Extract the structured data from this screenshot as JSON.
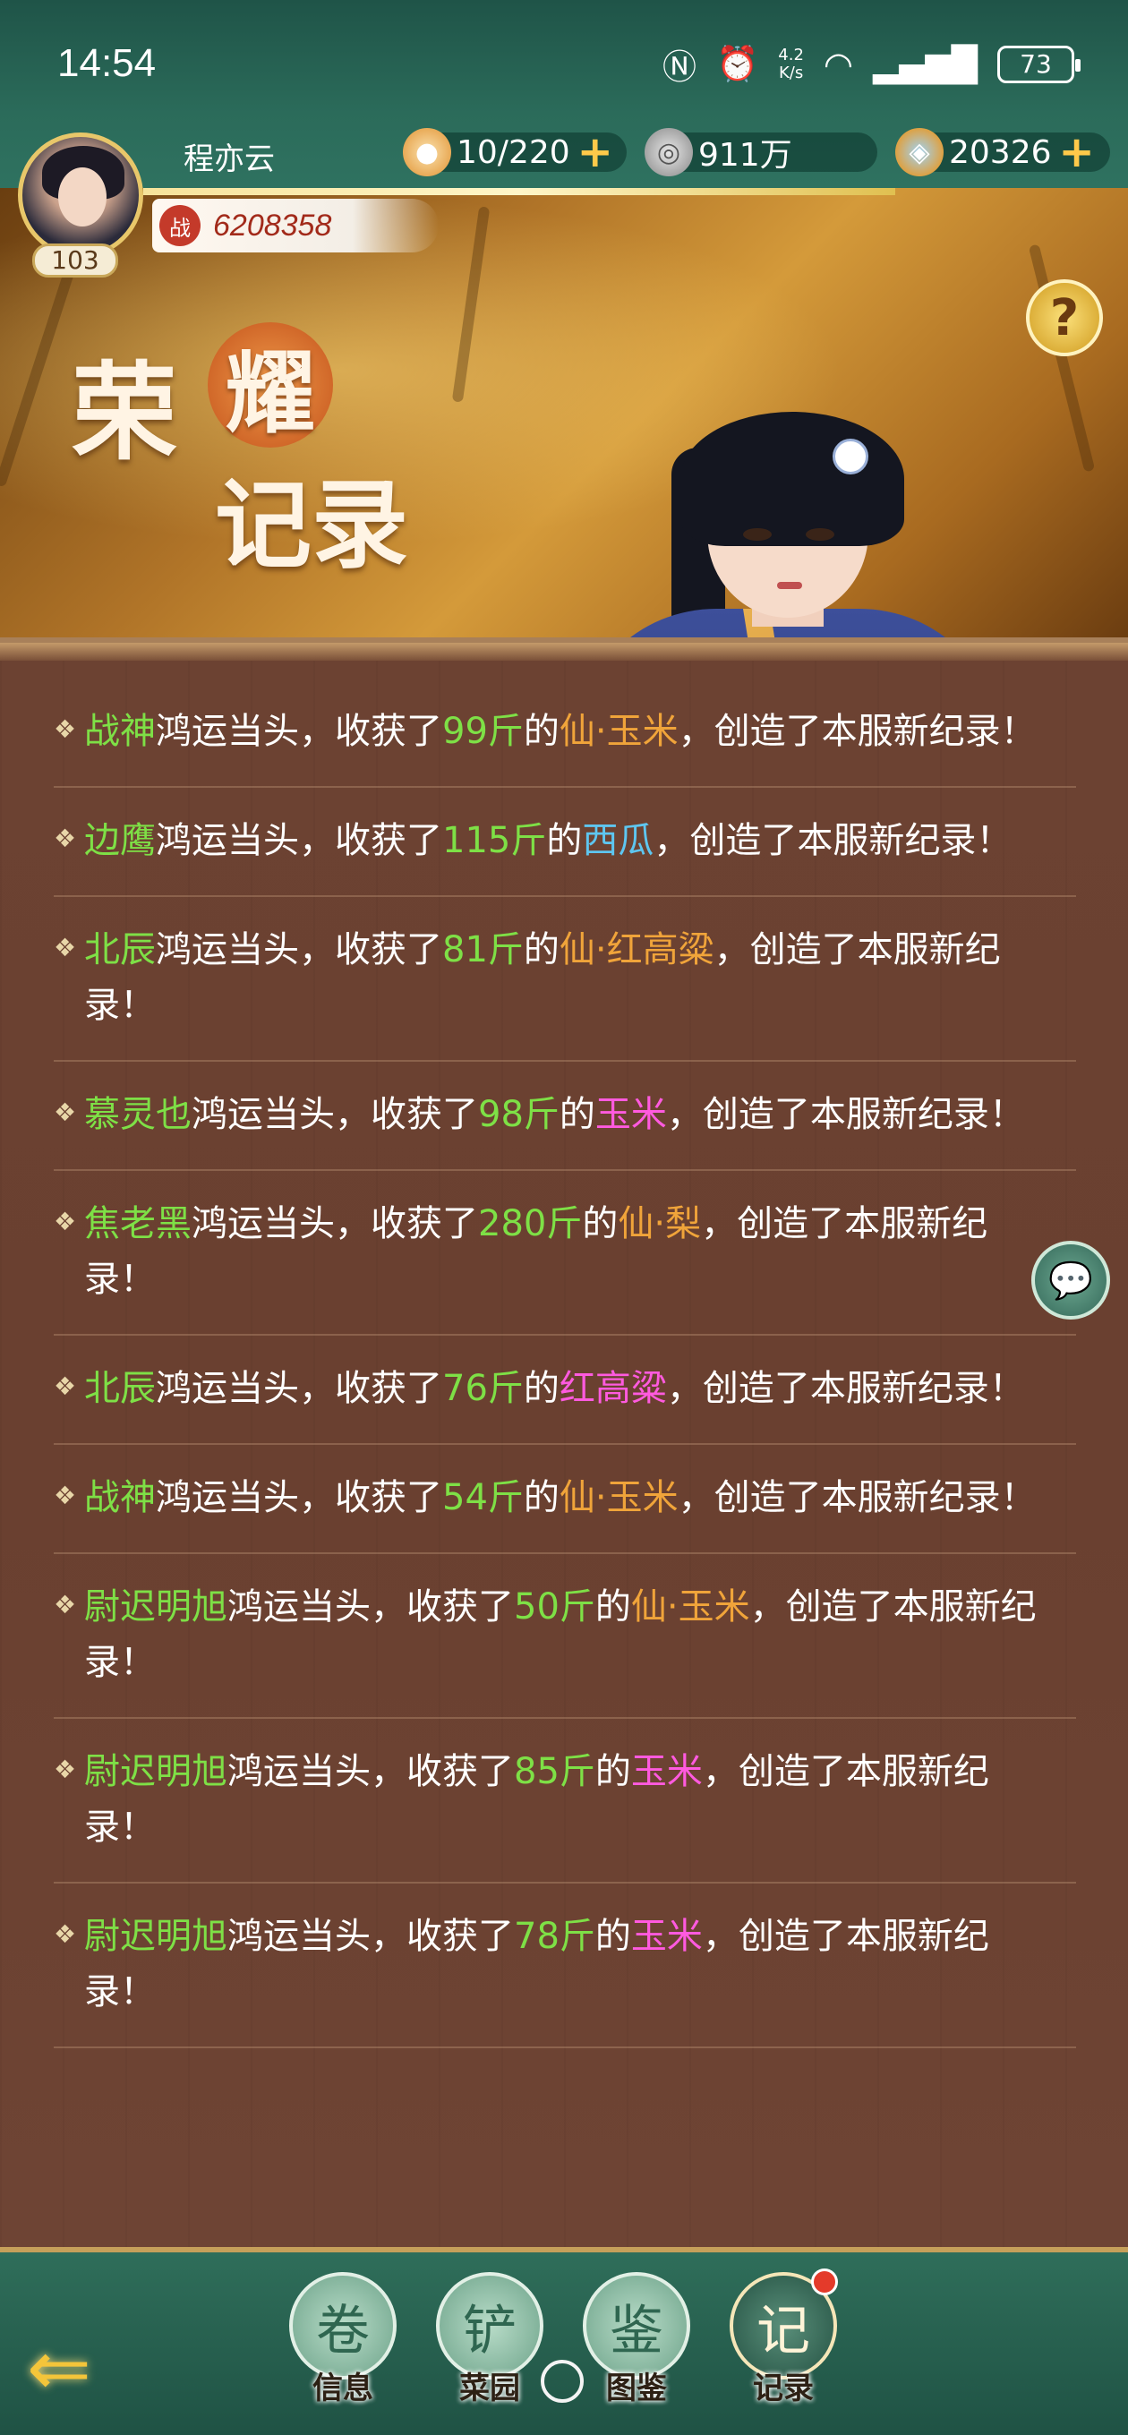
{
  "status_bar": {
    "time": "14:54",
    "net_speed_top": "4.2",
    "net_speed_bottom": "K/s",
    "battery": "73"
  },
  "player": {
    "name": "程亦云",
    "level": "103",
    "power_badge": "战",
    "power": "6208358"
  },
  "resources": {
    "stamina": "10/220",
    "coins": "911万",
    "gems": "20326"
  },
  "banner": {
    "title_char_1": "荣",
    "title_char_2": "耀",
    "title_line_2": "记录",
    "help_label": "?"
  },
  "records": [
    {
      "player": "战神",
      "mid": "鸿运当头，收获了",
      "amount": "99斤",
      "of": "的",
      "crop": "仙·玉米",
      "crop_color": "#f0a43a",
      "end": "，创造了本服新纪录！"
    },
    {
      "player": "边鹰",
      "mid": "鸿运当头，收获了",
      "amount": "115斤",
      "of": "的",
      "crop": "西瓜",
      "crop_color": "#5ec6f0",
      "end": "，创造了本服新纪录！"
    },
    {
      "player": "北辰",
      "mid": "鸿运当头，收获了",
      "amount": "81斤",
      "of": "的",
      "crop": "仙·红高粱",
      "crop_color": "#f0a43a",
      "end": "，创造了本服新纪录！"
    },
    {
      "player": "慕灵也",
      "mid": "鸿运当头，收获了",
      "amount": "98斤",
      "of": "的",
      "crop": "玉米",
      "crop_color": "#ff5adf",
      "end": "，创造了本服新纪录！"
    },
    {
      "player": "焦老黑",
      "mid": "鸿运当头，收获了",
      "amount": "280斤",
      "of": "的",
      "crop": "仙·梨",
      "crop_color": "#f0a43a",
      "end": "，创造了本服新纪录！"
    },
    {
      "player": "北辰",
      "mid": "鸿运当头，收获了",
      "amount": "76斤",
      "of": "的",
      "crop": "红高粱",
      "crop_color": "#ff5adf",
      "end": "，创造了本服新纪录！"
    },
    {
      "player": "战神",
      "mid": "鸿运当头，收获了",
      "amount": "54斤",
      "of": "的",
      "crop": "仙·玉米",
      "crop_color": "#f0a43a",
      "end": "，创造了本服新纪录！"
    },
    {
      "player": "尉迟明旭",
      "mid": "鸿运当头，收获了",
      "amount": "50斤",
      "of": "的",
      "crop": "仙·玉米",
      "crop_color": "#f0a43a",
      "end": "，创造了本服新纪录！"
    },
    {
      "player": "尉迟明旭",
      "mid": "鸿运当头，收获了",
      "amount": "85斤",
      "of": "的",
      "crop": "玉米",
      "crop_color": "#ff5adf",
      "end": "，创造了本服新纪录！"
    },
    {
      "player": "尉迟明旭",
      "mid": "鸿运当头，收获了",
      "amount": "78斤",
      "of": "的",
      "crop": "玉米",
      "crop_color": "#ff5adf",
      "end": "，创造了本服新纪录！"
    }
  ],
  "bottom_nav": {
    "back_icon": "back-arrow-icon",
    "items": [
      {
        "label": "信息",
        "icon": "scroll-icon",
        "glyph": "卷"
      },
      {
        "label": "菜园",
        "icon": "shovel-icon",
        "glyph": "铲"
      },
      {
        "label": "图鉴",
        "icon": "pumpkin-card-icon",
        "glyph": "鉴"
      },
      {
        "label": "记录",
        "icon": "record-scroll-icon",
        "glyph": "记"
      }
    ],
    "active": "记录"
  },
  "colors": {
    "player_name": "#7ee046",
    "amount": "#7ee046",
    "panel_bg": "#6a4030",
    "header_bg": "#2b6b5a"
  }
}
